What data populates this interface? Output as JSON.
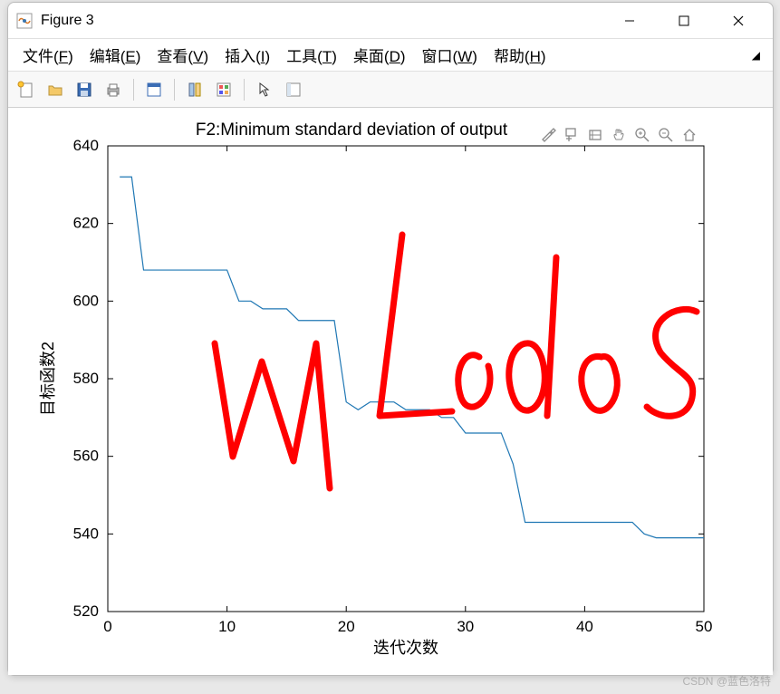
{
  "window": {
    "title": "Figure 3"
  },
  "menu": {
    "file": "文件(F)",
    "edit": "编辑(E)",
    "view": "查看(V)",
    "insert": "插入(I)",
    "tools": "工具(T)",
    "desktop": "桌面(D)",
    "window": "窗口(W)",
    "help": "帮助(H)"
  },
  "toolbar_icons": {
    "new": "new-figure",
    "open": "open",
    "save": "save",
    "print": "print",
    "datacursor": "datacursor",
    "link": "link",
    "colorbar": "colorbar",
    "arrow": "arrow",
    "inspect": "inspect"
  },
  "axes_tools": {
    "brush": "brush",
    "datatip": "datatip",
    "pan": "pan",
    "rotate": "rotate",
    "zoomin": "zoomin",
    "zoomout": "zoomout",
    "home": "home"
  },
  "chart_data": {
    "type": "line",
    "title": "F2:Minimum standard deviation of output",
    "xlabel": "迭代次数",
    "ylabel": "目标函数2",
    "xlim": [
      0,
      50
    ],
    "ylim": [
      520,
      640
    ],
    "xticks": [
      0,
      10,
      20,
      30,
      40,
      50
    ],
    "yticks": [
      520,
      540,
      560,
      580,
      600,
      620,
      640
    ],
    "x": [
      1,
      2,
      3,
      4,
      5,
      6,
      7,
      8,
      9,
      10,
      11,
      12,
      13,
      14,
      15,
      16,
      17,
      18,
      19,
      20,
      21,
      22,
      23,
      24,
      25,
      26,
      27,
      28,
      29,
      30,
      31,
      32,
      33,
      34,
      35,
      36,
      37,
      38,
      39,
      40,
      41,
      42,
      43,
      44,
      45,
      46,
      47,
      48,
      49,
      50
    ],
    "y": [
      632,
      632,
      608,
      608,
      608,
      608,
      608,
      608,
      608,
      608,
      600,
      600,
      598,
      598,
      598,
      595,
      595,
      595,
      595,
      574,
      572,
      574,
      574,
      574,
      572,
      572,
      572,
      570,
      570,
      566,
      566,
      566,
      566,
      558,
      543,
      543,
      543,
      543,
      543,
      543,
      543,
      543,
      543,
      543,
      540,
      539,
      539,
      539,
      539,
      539
    ]
  },
  "annotation": {
    "scribble_text": "WL codes",
    "color": "#ff0000"
  },
  "watermark": "CSDN @蓝色洛特"
}
